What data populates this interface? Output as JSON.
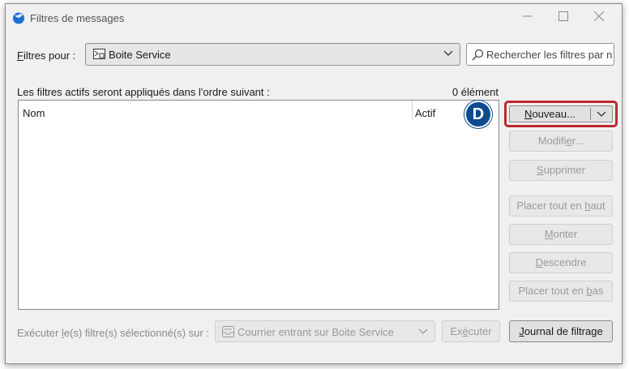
{
  "window": {
    "title": "Filtres de messages"
  },
  "filters_for": {
    "label_accel": "F",
    "label_rest": "iltres pour :",
    "account": "Boite Service",
    "search_placeholder": "Rechercher les filtres par nom…"
  },
  "list": {
    "order_label": "Les filtres actifs seront appliqués dans l'ordre suivant :",
    "count": "0 élément",
    "columns": {
      "name": "Nom",
      "active": "Actif"
    },
    "rows": []
  },
  "badge": "D",
  "buttons": {
    "new_accel": "N",
    "new_rest": "ouveau...",
    "edit_pre": "Modifi",
    "edit_accel": "e",
    "edit_post": "r...",
    "delete_accel": "S",
    "delete_rest": "upprimer",
    "top_pre": "Placer tout en ",
    "top_accel": "h",
    "top_post": "aut",
    "up_accel": "M",
    "up_rest": "onter",
    "down_accel": "D",
    "down_rest": "escendre",
    "bottom_pre": "Placer tout en ",
    "bottom_accel": "b",
    "bottom_post": "as"
  },
  "footer": {
    "exec_pre": "Exécuter ",
    "exec_accel": "l",
    "exec_post": "e(s) filtre(s) sélectionné(s) sur :",
    "exec_target": "Courrier entrant sur Boite Service",
    "run_pre": "Ex",
    "run_accel": "é",
    "run_post": "cuter",
    "log_accel": "J",
    "log_rest": "ournal de filtrage"
  },
  "colors": {
    "highlight": "#c0282d",
    "badge": "#0d4a8e",
    "app_icon": "#1d6fd1"
  }
}
